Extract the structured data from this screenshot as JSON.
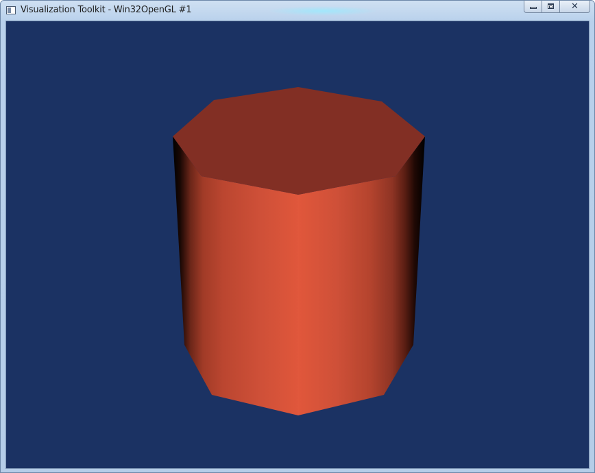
{
  "window": {
    "title": "Visualization Toolkit - Win32OpenGL #1",
    "icon": "app-window-icon"
  },
  "caption_buttons": {
    "minimize_icon": "minimize-icon",
    "maximize_icon": "maximize-icon",
    "close_icon": "close-icon",
    "close_glyph": "✕"
  },
  "scene": {
    "background_color": "#1b3263",
    "object": "octagonal-cylinder",
    "object_color": "#e0573b",
    "top_face_color": "#822f24",
    "shadow_color": "#000000"
  }
}
